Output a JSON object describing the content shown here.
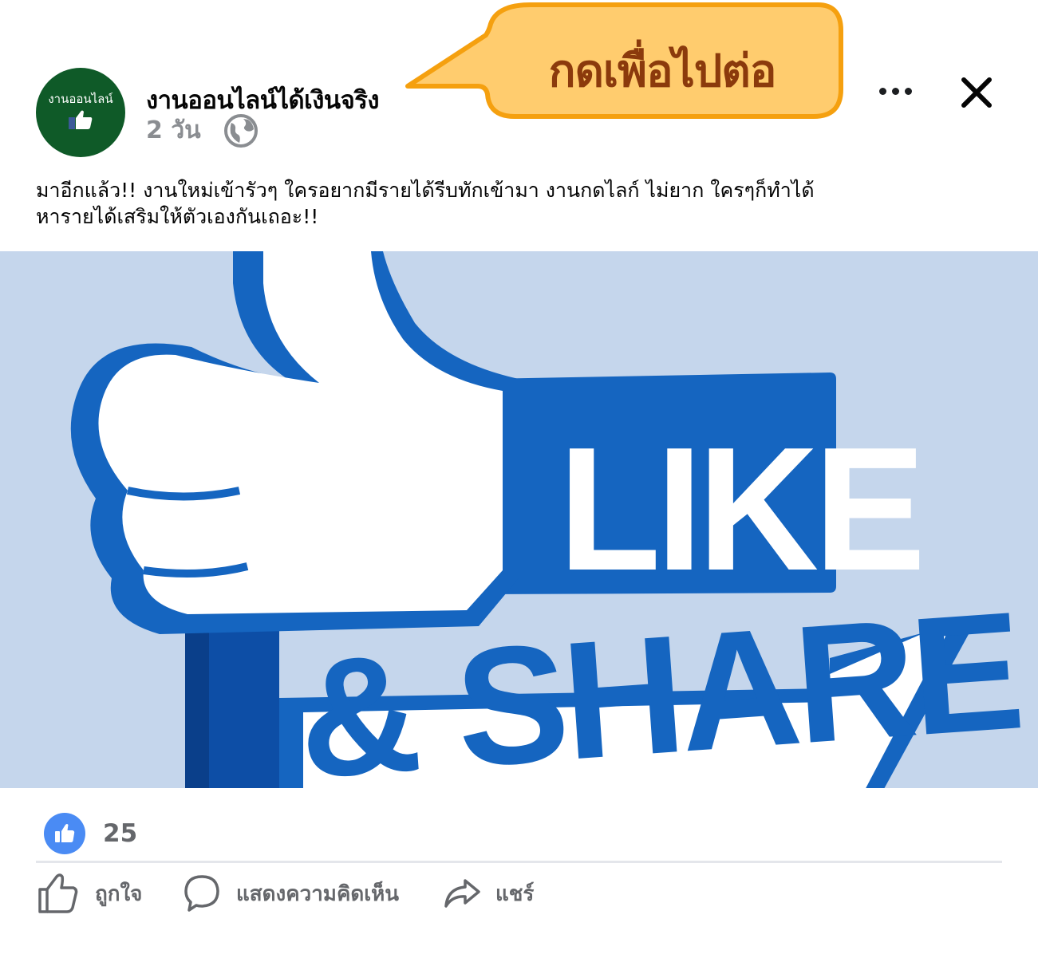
{
  "post": {
    "page_name": "งานออนไลน์ได้เงินจริง",
    "avatar_text": "งานออนไลน์",
    "time": "2 วัน",
    "privacy_icon": "globe-icon",
    "callout": "กดเพื่อไปต่อ",
    "caption_line1": "มาอีกแล้ว!! งานใหม่เข้ารัวๆ ใครอยากมีรายได้รีบทักเข้ามา งานกดไลก์ ไม่ยาก ใครๆก็ทำได้",
    "caption_line2": "หารายได้เสริมให้ตัวเองกันเถอะ!!"
  },
  "image": {
    "word_like": "LIKE",
    "word_share": "& SHARE"
  },
  "reactions": {
    "count": "25",
    "icon": "like-icon"
  },
  "actions": {
    "like": "ถูกใจ",
    "comment": "แสดงความคิดเห็น",
    "share": "แชร์"
  },
  "colors": {
    "accent_blue": "#1565c0",
    "callout_fill": "#ffcc6e",
    "callout_border": "#f5a00f",
    "avatar_bg": "#0f5a28",
    "like_badge": "#4a8bf4"
  }
}
